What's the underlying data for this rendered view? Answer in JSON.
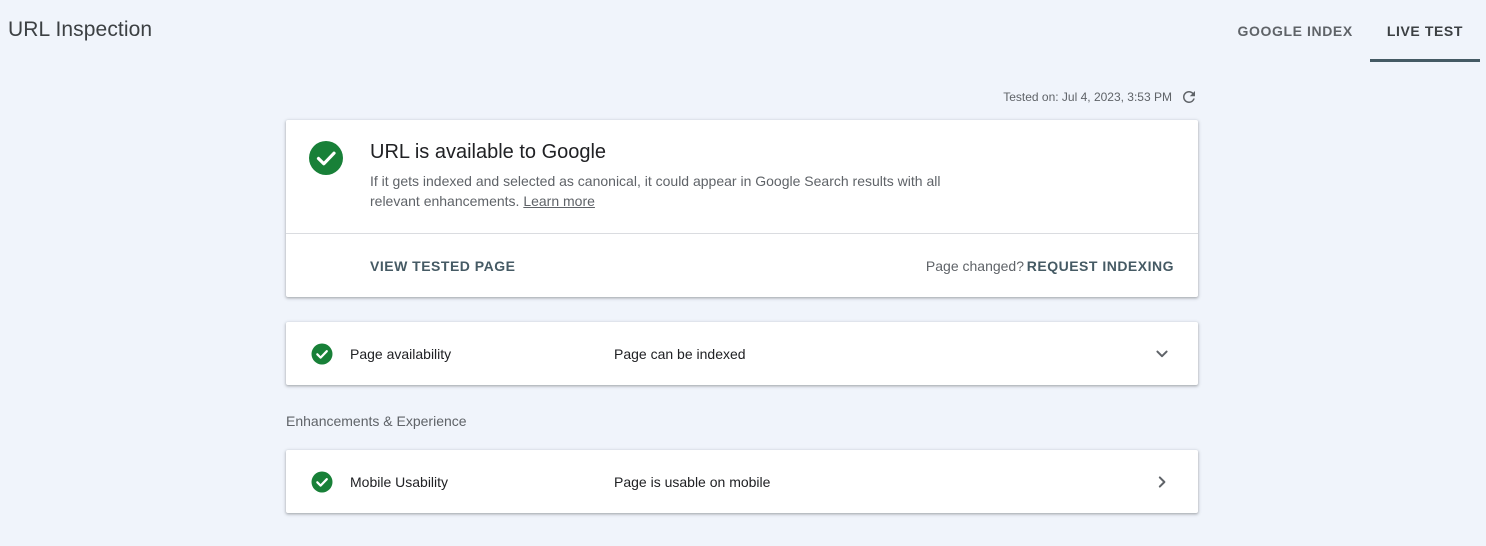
{
  "header": {
    "title": "URL Inspection",
    "tabs": [
      {
        "label": "GOOGLE INDEX",
        "active": false
      },
      {
        "label": "LIVE TEST",
        "active": true
      }
    ]
  },
  "tested_on": {
    "text": "Tested on: Jul 4, 2023, 3:53 PM",
    "icon": "refresh-icon"
  },
  "status_card": {
    "icon": "check-circle-icon",
    "title": "URL is available to Google",
    "description": "If it gets indexed and selected as canonical, it could appear in Google Search results with all relevant enhancements.",
    "learn_more": "Learn more",
    "view_tested_page": "VIEW TESTED PAGE",
    "page_changed": "Page changed?",
    "request_indexing": "REQUEST INDEXING"
  },
  "page_availability": {
    "label": "Page availability",
    "value": "Page can be indexed",
    "icon": "check-circle-icon",
    "chevron": "chevron-down-icon"
  },
  "enhancements": {
    "heading": "Enhancements & Experience",
    "items": [
      {
        "label": "Mobile Usability",
        "value": "Page is usable on mobile",
        "icon": "check-circle-icon",
        "chevron": "chevron-right-icon"
      }
    ]
  },
  "colors": {
    "background": "#f0f4fb",
    "success_green": "#188038",
    "accent": "#455a64"
  }
}
